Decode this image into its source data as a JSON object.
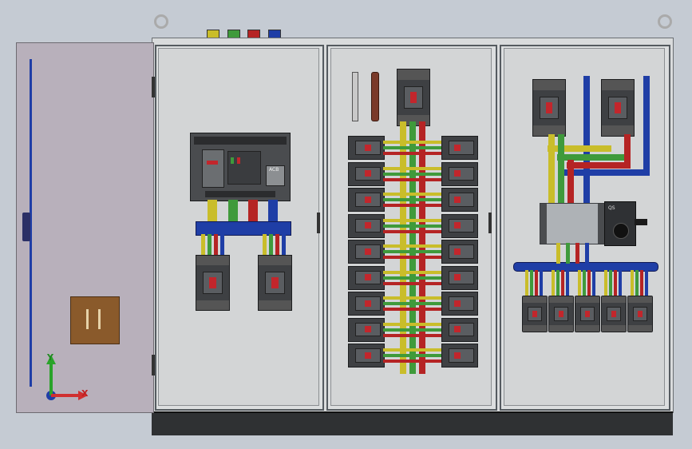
{
  "scene": {
    "background": "#c5cbd3",
    "phase_colors": {
      "L1": "#c9bd2a",
      "L2": "#3f9a3b",
      "L3": "#b52424",
      "N": "#1f3ea6"
    },
    "breaker_body": "#3e4043",
    "breaker_toggle": "#c2262c",
    "acb_label": "ACB",
    "load_switch_label": "QS",
    "terminal_colors": [
      "#c9bd2a",
      "#3f9a3b",
      "#b52424",
      "#1f3ea6"
    ]
  },
  "axes": {
    "y": "Y",
    "x": "X"
  },
  "layout": {
    "panel_count": 3,
    "door_count": 1,
    "middle_rows": 9,
    "right_bottom_breakers": 5
  }
}
